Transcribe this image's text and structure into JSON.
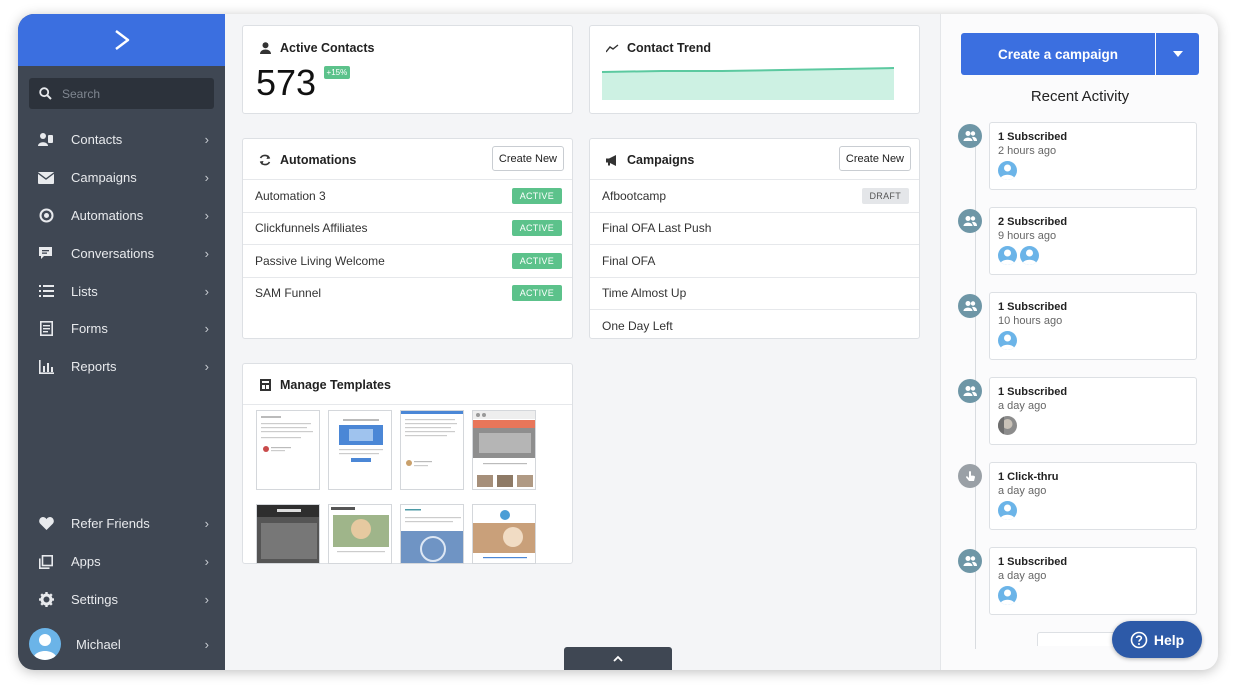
{
  "sidebar": {
    "search_placeholder": "Search",
    "items": [
      {
        "label": "Contacts",
        "icon": "contacts-icon"
      },
      {
        "label": "Campaigns",
        "icon": "envelope-icon"
      },
      {
        "label": "Automations",
        "icon": "automations-icon"
      },
      {
        "label": "Conversations",
        "icon": "chat-icon"
      },
      {
        "label": "Lists",
        "icon": "list-icon"
      },
      {
        "label": "Forms",
        "icon": "form-icon"
      },
      {
        "label": "Reports",
        "icon": "bar-chart-icon"
      }
    ],
    "bottom_items": [
      {
        "label": "Refer Friends",
        "icon": "heart-icon"
      },
      {
        "label": "Apps",
        "icon": "apps-icon"
      },
      {
        "label": "Settings",
        "icon": "gear-icon"
      }
    ],
    "user": {
      "name": "Michael"
    }
  },
  "active_contacts": {
    "title": "Active Contacts",
    "value": "573",
    "change": "+15%"
  },
  "contact_trend": {
    "title": "Contact Trend"
  },
  "automations": {
    "title": "Automations",
    "button": "Create New",
    "rows": [
      {
        "name": "Automation 3",
        "status": "ACTIVE"
      },
      {
        "name": "Clickfunnels Affiliates",
        "status": "ACTIVE"
      },
      {
        "name": "Passive Living Welcome",
        "status": "ACTIVE"
      },
      {
        "name": "SAM Funnel",
        "status": "ACTIVE"
      }
    ]
  },
  "campaigns": {
    "title": "Campaigns",
    "button": "Create New",
    "rows": [
      {
        "name": "Afbootcamp",
        "status": "DRAFT"
      },
      {
        "name": "Final OFA Last Push",
        "status": ""
      },
      {
        "name": "Final OFA",
        "status": ""
      },
      {
        "name": "Time Almost Up",
        "status": ""
      },
      {
        "name": "One Day Left",
        "status": ""
      }
    ]
  },
  "templates": {
    "title": "Manage Templates"
  },
  "right": {
    "create_button": "Create a campaign",
    "recent_title": "Recent Activity",
    "activities": [
      {
        "title": "1 Subscribed",
        "time": "2 hours ago",
        "icon": "subscribers-icon"
      },
      {
        "title": "2 Subscribed",
        "time": "9 hours ago",
        "icon": "subscribers-icon"
      },
      {
        "title": "1 Subscribed",
        "time": "10 hours ago",
        "icon": "subscribers-icon"
      },
      {
        "title": "1 Subscribed",
        "time": "a day ago",
        "icon": "subscribers-icon"
      },
      {
        "title": "1 Click-thru",
        "time": "a day ago",
        "icon": "click-icon"
      },
      {
        "title": "1 Subscribed",
        "time": "a day ago",
        "icon": "subscribers-icon"
      }
    ],
    "help": "Help"
  },
  "colors": {
    "brand_blue": "#3b6fe0",
    "sidebar": "#3f4753",
    "active_green": "#5cc28b",
    "trend_line": "#5cc9a0"
  }
}
